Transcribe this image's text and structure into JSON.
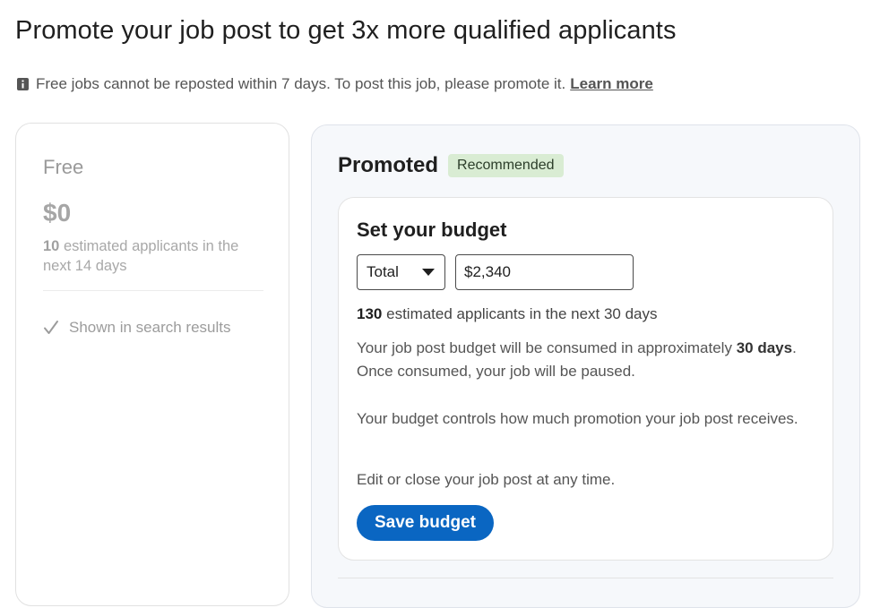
{
  "page": {
    "title": "Promote your job post to get 3x more qualified applicants"
  },
  "notice": {
    "text": "Free jobs cannot be reposted within 7 days. To post this job, please promote it.",
    "link": "Learn more",
    "icon": "info-icon"
  },
  "free": {
    "title": "Free",
    "price": "$0",
    "applicants_count": "10",
    "applicants_text": "estimated applicants in the next 14 days",
    "feature": "Shown in search results",
    "feature_icon": "check-icon"
  },
  "promoted": {
    "title": "Promoted",
    "badge": "Recommended",
    "budget": {
      "title": "Set your budget",
      "type_selected": "Total",
      "amount_value": "$2,340",
      "applicants_count": "130",
      "applicants_text": "estimated applicants in the next 30 days",
      "consumed_prefix": "Your job post budget will be consumed in approximately",
      "consumed_days": "30 days",
      "consumed_suffix": ". Once consumed, your job will be paused.",
      "controls_text": "Your budget controls how much promotion your job post receives.",
      "edit_text": "Edit or close your job post at any time.",
      "save_label": "Save budget"
    }
  },
  "colors": {
    "primary": "#0a66c2",
    "badge_bg": "#d9ecd3",
    "card_bg": "#f6f8fb"
  }
}
